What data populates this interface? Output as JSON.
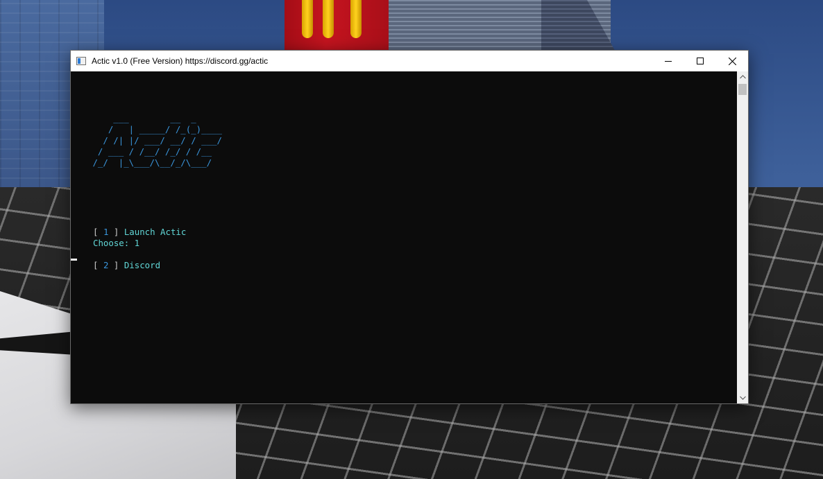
{
  "window": {
    "title": "Actic v1.0 (Free Version) https://discord.gg/actic",
    "icon": "console-app-icon"
  },
  "caption_buttons": {
    "minimize_icon": "minimize-icon",
    "maximize_icon": "maximize-icon",
    "close_icon": "close-icon"
  },
  "console": {
    "ascii_logo": "     ___        __  _\n    /   | _____/ /_(_)____\n   / /| |/ ___/ __/ / ___/\n  / ___ / /__/ /_/ / /__\n /_/  |_\\___/\\__/_/\\___/",
    "menu": [
      {
        "open": "[",
        "number": "1",
        "close": "]",
        "label": "Launch Actic"
      },
      {
        "open": "[",
        "number": "2",
        "close": "]",
        "label": "Discord"
      }
    ],
    "prompt": "Choose: 1"
  },
  "colors": {
    "console_background": "#0c0c0c",
    "logo": "#3a96dd",
    "menu_label": "#61d6d6",
    "bracket": "#cccccc"
  }
}
